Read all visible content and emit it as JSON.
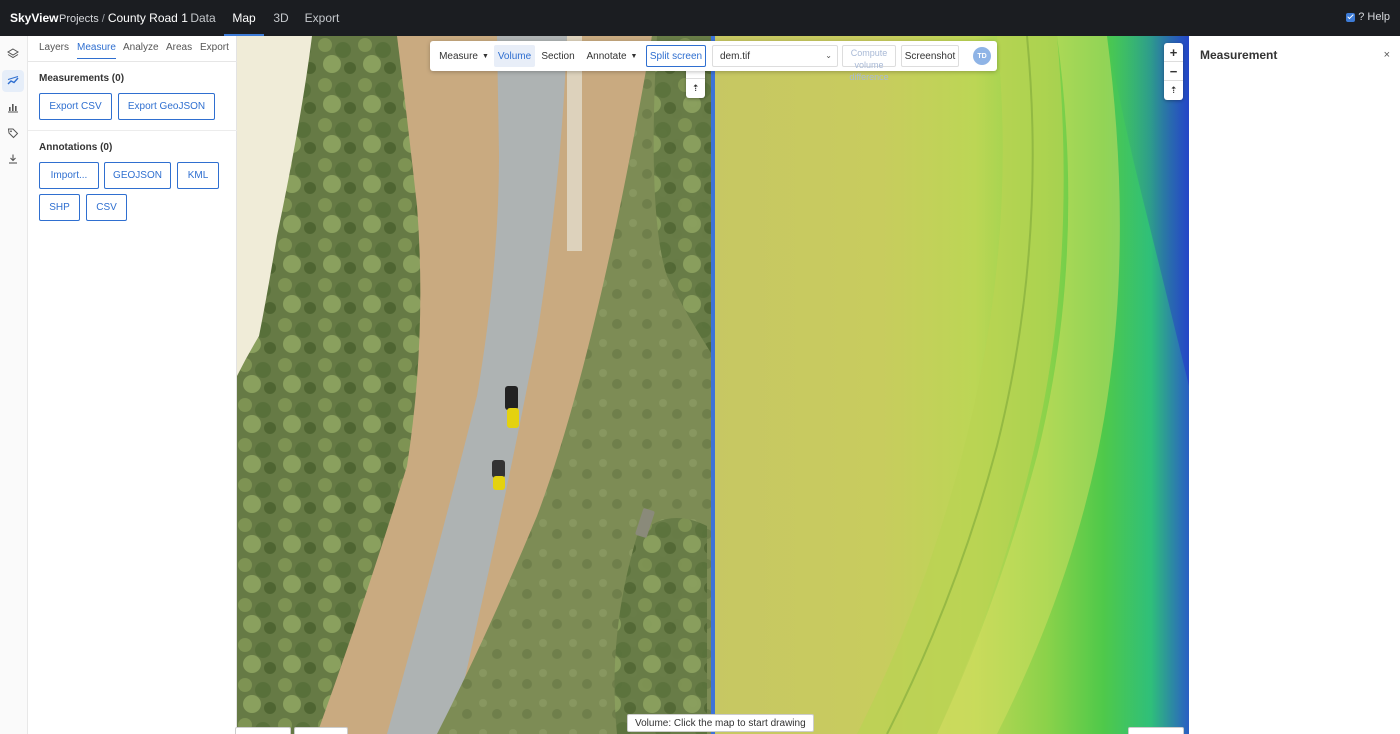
{
  "app": {
    "brand": "SkyView"
  },
  "breadcrumb": {
    "projects": "Projects",
    "separator": "/",
    "current": "County Road 1"
  },
  "top_nav": {
    "data": "Data",
    "map": "Map",
    "three_d": "3D",
    "export": "Export",
    "active": "Map"
  },
  "help": {
    "label": "? Help",
    "checked": true
  },
  "rail": {
    "icons": [
      "layers-icon",
      "measure-icon",
      "chart-icon",
      "tag-icon",
      "download-icon"
    ],
    "active": "measure-icon"
  },
  "panel": {
    "tabs": {
      "layers": "Layers",
      "measure": "Measure",
      "analyze": "Analyze",
      "areas": "Areas",
      "export": "Export",
      "active": "Measure"
    },
    "measurements_title": "Measurements (0)",
    "export_csv": "Export CSV",
    "export_geojson": "Export GeoJSON",
    "annotations_title": "Annotations (0)",
    "import": "Import...",
    "geojson": "GEOJSON",
    "kml": "KML",
    "shp": "SHP",
    "csv": "CSV"
  },
  "toolbar": {
    "measure": "Measure",
    "volume": "Volume",
    "section": "Section",
    "annotate": "Annotate",
    "split_screen": "Split screen",
    "layer_select": "dem.tif",
    "compute": "Compute volume difference",
    "screenshot": "Screenshot",
    "avatar": "TD",
    "active": "Volume"
  },
  "zoom": {
    "in": "+",
    "out": "−",
    "reset": "⇡"
  },
  "status": {
    "text": "Volume: Click the map to start drawing"
  },
  "right_panel": {
    "title": "Measurement",
    "close": "×"
  },
  "colors": {
    "accent": "#2f6fd0",
    "topbar": "#1b1d21",
    "split_line": "#3d73d8"
  }
}
